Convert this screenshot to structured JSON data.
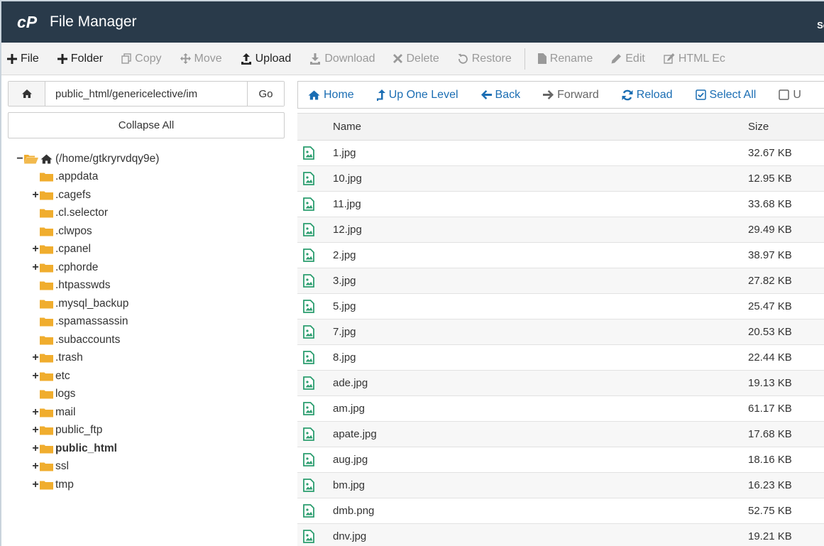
{
  "header": {
    "title": "File Manager",
    "search_label": "Se"
  },
  "toolbar": [
    {
      "key": "file",
      "label": "File",
      "icon": "plus-icon",
      "enabled": true
    },
    {
      "key": "folder",
      "label": "Folder",
      "icon": "plus-icon",
      "enabled": true
    },
    {
      "key": "copy",
      "label": "Copy",
      "icon": "copy-icon",
      "enabled": false
    },
    {
      "key": "move",
      "label": "Move",
      "icon": "move-icon",
      "enabled": false
    },
    {
      "key": "upload",
      "label": "Upload",
      "icon": "upload-icon",
      "enabled": true
    },
    {
      "key": "download",
      "label": "Download",
      "icon": "download-icon",
      "enabled": false
    },
    {
      "key": "delete",
      "label": "Delete",
      "icon": "x-icon",
      "enabled": false
    },
    {
      "key": "restore",
      "label": "Restore",
      "icon": "restore-icon",
      "enabled": false
    },
    {
      "key": "rename",
      "label": "Rename",
      "icon": "file-icon",
      "enabled": false
    },
    {
      "key": "edit",
      "label": "Edit",
      "icon": "pencil-icon",
      "enabled": false
    },
    {
      "key": "html-editor",
      "label": "HTML Ec",
      "icon": "edit-box-icon",
      "enabled": false
    }
  ],
  "path": {
    "value": "public_html/genericelective/im",
    "go_label": "Go"
  },
  "collapse_label": "Collapse All",
  "tree": {
    "root": "(/home/gtkryrvdqy9e)",
    "items": [
      {
        "label": ".appdata",
        "toggle": ""
      },
      {
        "label": ".cagefs",
        "toggle": "+"
      },
      {
        "label": ".cl.selector",
        "toggle": ""
      },
      {
        "label": ".clwpos",
        "toggle": ""
      },
      {
        "label": ".cpanel",
        "toggle": "+"
      },
      {
        "label": ".cphorde",
        "toggle": "+"
      },
      {
        "label": ".htpasswds",
        "toggle": ""
      },
      {
        "label": ".mysql_backup",
        "toggle": ""
      },
      {
        "label": ".spamassassin",
        "toggle": ""
      },
      {
        "label": ".subaccounts",
        "toggle": ""
      },
      {
        "label": ".trash",
        "toggle": "+"
      },
      {
        "label": "etc",
        "toggle": "+"
      },
      {
        "label": "logs",
        "toggle": ""
      },
      {
        "label": "mail",
        "toggle": "+"
      },
      {
        "label": "public_ftp",
        "toggle": "+"
      },
      {
        "label": "public_html",
        "toggle": "+",
        "bold": true
      },
      {
        "label": "ssl",
        "toggle": "+"
      },
      {
        "label": "tmp",
        "toggle": "+"
      }
    ]
  },
  "nav": [
    {
      "key": "home",
      "label": "Home",
      "icon": "home-icon"
    },
    {
      "key": "up-one-level",
      "label": "Up One Level",
      "icon": "level-up-icon"
    },
    {
      "key": "back",
      "label": "Back",
      "icon": "arrow-left-icon"
    },
    {
      "key": "forward",
      "label": "Forward",
      "icon": "arrow-right-icon",
      "muted": true
    },
    {
      "key": "reload",
      "label": "Reload",
      "icon": "refresh-icon"
    },
    {
      "key": "select-all",
      "label": "Select All",
      "icon": "checkbox-checked-icon"
    },
    {
      "key": "unselect-all",
      "label": "U",
      "icon": "checkbox-icon",
      "muted": true
    }
  ],
  "table": {
    "columns": {
      "name": "Name",
      "size": "Size"
    },
    "rows": [
      {
        "name": "1.jpg",
        "size": "32.67 KB"
      },
      {
        "name": "10.jpg",
        "size": "12.95 KB"
      },
      {
        "name": "11.jpg",
        "size": "33.68 KB"
      },
      {
        "name": "12.jpg",
        "size": "29.49 KB"
      },
      {
        "name": "2.jpg",
        "size": "38.97 KB"
      },
      {
        "name": "3.jpg",
        "size": "27.82 KB"
      },
      {
        "name": "5.jpg",
        "size": "25.47 KB"
      },
      {
        "name": "7.jpg",
        "size": "20.53 KB"
      },
      {
        "name": "8.jpg",
        "size": "22.44 KB"
      },
      {
        "name": "ade.jpg",
        "size": "19.13 KB"
      },
      {
        "name": "am.jpg",
        "size": "61.17 KB"
      },
      {
        "name": "apate.jpg",
        "size": "17.68 KB"
      },
      {
        "name": "aug.jpg",
        "size": "18.16 KB"
      },
      {
        "name": "bm.jpg",
        "size": "16.23 KB"
      },
      {
        "name": "dmb.png",
        "size": "52.75 KB"
      },
      {
        "name": "dnv.jpg",
        "size": "19.21 KB"
      }
    ]
  },
  "colors": {
    "header_bg": "#293a4a",
    "link": "#1a6db3",
    "folder": "#f0ad2e",
    "image_icon": "#2a9d6e"
  }
}
